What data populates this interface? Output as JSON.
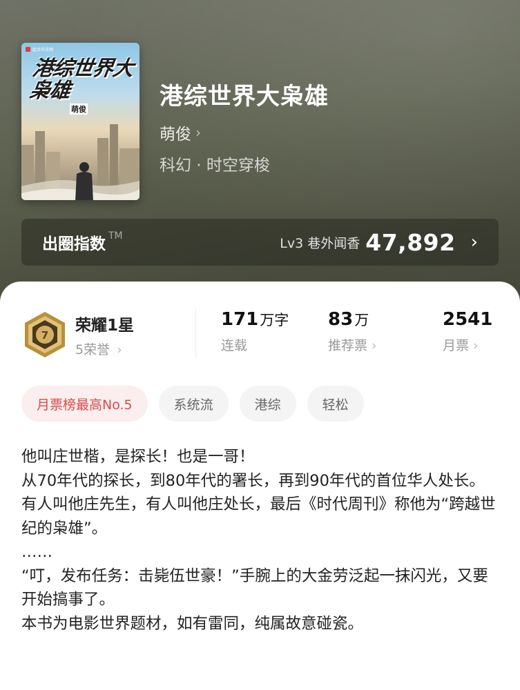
{
  "book": {
    "cover": {
      "publisher": "起点中文网",
      "title": "港综世界大枭雄",
      "author": "萌俊"
    },
    "title": "港综世界大枭雄",
    "author": "萌俊",
    "genre": "科幻 · 时空穿梭"
  },
  "influence": {
    "label": "出圈指数",
    "tm": "TM",
    "level": "Lv3 巷外闻香",
    "score": "47,892"
  },
  "honor": {
    "badge_number": "7",
    "title": "荣耀1星",
    "sub": "5荣誉"
  },
  "stats": [
    {
      "value": "171",
      "unit": "万字",
      "label": "连载",
      "has_arrow": false
    },
    {
      "value": "83",
      "unit": "万",
      "label": "推荐票",
      "has_arrow": true
    },
    {
      "value": "2541",
      "unit": "",
      "label": "月票",
      "has_arrow": true
    }
  ],
  "tags": [
    "月票榜最高No.5",
    "系统流",
    "港综",
    "轻松"
  ],
  "description": [
    "他叫庄世楷，是探长！也是一哥！",
    "从70年代的探长，到80年代的署长，再到90年代的首位华人处长。",
    "有人叫他庄先生，有人叫他庄处长，最后《时代周刊》称他为“跨越世纪的枭雄”。",
    "……",
    "“叮，发布任务：击毙伍世豪！”手腕上的大金劳泛起一抹闪光，又要开始搞事了。",
    "本书为电影世界题材，如有雷同，纯属故意碰瓷。"
  ],
  "colors": {
    "header_bg": "#5e6250",
    "influence_bg": "#3a3c2e",
    "hot_tag_text": "#d94a4a",
    "hot_tag_bg": "#fbeeee",
    "badge_gold": "#c9a14a"
  }
}
